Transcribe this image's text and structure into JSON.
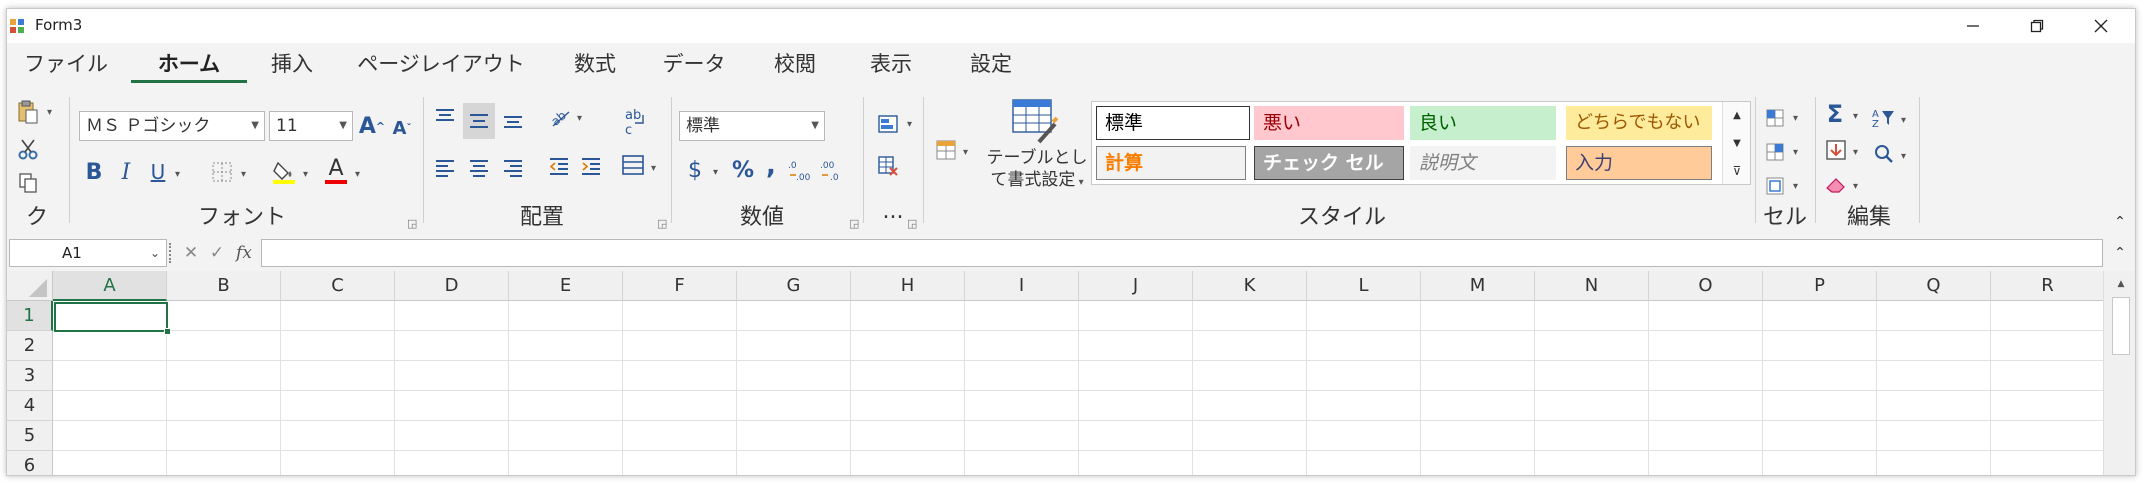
{
  "window": {
    "title": "Form3",
    "minimize_icon": "minimize-icon",
    "maximize_icon": "restore-icon",
    "close_icon": "close-icon"
  },
  "tabs": [
    {
      "label": "ファイル",
      "active": false
    },
    {
      "label": "ホーム",
      "active": true
    },
    {
      "label": "挿入",
      "active": false
    },
    {
      "label": "ページレイアウト",
      "active": false
    },
    {
      "label": "数式",
      "active": false
    },
    {
      "label": "データ",
      "active": false
    },
    {
      "label": "校閲",
      "active": false
    },
    {
      "label": "表示",
      "active": false
    },
    {
      "label": "設定",
      "active": false
    }
  ],
  "ribbon": {
    "groups": {
      "clipboard": "クリ...",
      "font": "フォント",
      "alignment": "配置",
      "number": "数値",
      "more": "...",
      "styles": "スタイル",
      "cells": "セル",
      "editing": "編集"
    },
    "font_name": "ＭＳ Ｐゴシック",
    "font_size": "11",
    "number_format": "標準",
    "currency_symbol": "$",
    "percent_symbol": "%",
    "comma_symbol": ",",
    "table_format_label_1": "テーブルとし",
    "table_format_label_2": "て書式設定",
    "bold": "B",
    "italic": "I",
    "underline": "U",
    "grow_font": "A",
    "shrink_font": "A",
    "font_color": "A",
    "sum_symbol": "Σ",
    "styles": [
      {
        "label": "標準",
        "bg": "#ffffff",
        "fg": "#000000",
        "border": "#333333"
      },
      {
        "label": "悪い",
        "bg": "#ffc7ce",
        "fg": "#9c0006",
        "border": "#ffc7ce"
      },
      {
        "label": "良い",
        "bg": "#c6efce",
        "fg": "#006100",
        "border": "#c6efce"
      },
      {
        "label": "どちらでもない",
        "bg": "#ffeb9c",
        "fg": "#9c5700",
        "border": "#ffeb9c"
      },
      {
        "label": "計算",
        "bg": "#f2f2f2",
        "fg": "#fa7d00",
        "border": "#7f7f7f"
      },
      {
        "label": "チェック セル",
        "bg": "#a5a5a5",
        "fg": "#ffffff",
        "border": "#3f3f3f"
      },
      {
        "label": "説明文",
        "bg": "#f3f3f3",
        "fg": "#7f7f7f",
        "border": "#f3f3f3"
      },
      {
        "label": "入力",
        "bg": "#ffcc99",
        "fg": "#3f3f76",
        "border": "#7f7f7f"
      }
    ]
  },
  "formula_bar": {
    "name_box": "A1",
    "cancel": "✕",
    "enter": "✓",
    "fx": "fx",
    "value": ""
  },
  "grid": {
    "columns": [
      "A",
      "B",
      "C",
      "D",
      "E",
      "F",
      "G",
      "H",
      "I",
      "J",
      "K",
      "L",
      "M",
      "N",
      "O",
      "P",
      "Q",
      "R"
    ],
    "rows": [
      "1",
      "2",
      "3",
      "4",
      "5",
      "6"
    ],
    "selected_cell": "A1"
  },
  "colors": {
    "accent": "#217346",
    "selection": "#217346"
  }
}
